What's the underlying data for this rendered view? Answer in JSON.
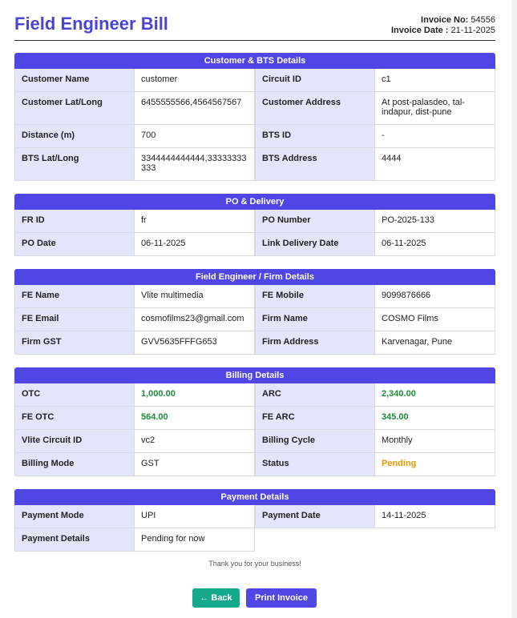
{
  "header": {
    "title": "Field Engineer Bill",
    "invoice_no_label": "Invoice No:",
    "invoice_no": "54556",
    "invoice_date_label": "Invoice Date :",
    "invoice_date": "21-11-2025"
  },
  "sections": {
    "customer": {
      "title": "Customer & BTS Details",
      "rows": [
        [
          "Customer Name",
          "customer",
          "Circuit ID",
          "c1"
        ],
        [
          "Customer Lat/Long",
          "6455555566,4564567567",
          "Customer Address",
          "At post-palasdeo, tal-indapur, dist-pune"
        ],
        [
          "Distance (m)",
          "700",
          "BTS ID",
          "-"
        ],
        [
          "BTS Lat/Long",
          "3344444444444,33333333333",
          "BTS Address",
          "4444"
        ]
      ]
    },
    "po": {
      "title": "PO & Delivery",
      "rows": [
        [
          "FR ID",
          "fr",
          "PO Number",
          "PO-2025-133"
        ],
        [
          "PO Date",
          "06-11-2025",
          "Link Delivery Date",
          "06-11-2025"
        ]
      ]
    },
    "fe": {
      "title": "Field Engineer / Firm Details",
      "rows": [
        [
          "FE Name",
          "Vlite multimedia",
          "FE Mobile",
          "9099876666"
        ],
        [
          "FE Email",
          "cosmofilms23@gmail.com",
          "Firm Name",
          "COSMO Films"
        ],
        [
          "Firm GST",
          "GVV5635FFFG653",
          "Firm Address",
          "Karvenagar, Pune"
        ]
      ]
    },
    "billing": {
      "title": "Billing Details",
      "rows": [
        [
          "OTC",
          "1,000.00",
          "ARC",
          "2,340.00"
        ],
        [
          "FE OTC",
          "564.00",
          "FE ARC",
          "345.00"
        ],
        [
          "Vlite Circuit ID",
          "vc2",
          "Billing Cycle",
          "Monthly"
        ],
        [
          "Billing Mode",
          "GST",
          "Status",
          "Pending"
        ]
      ]
    },
    "payment": {
      "title": "Payment Details",
      "rows": [
        [
          "Payment Mode",
          "UPI",
          "Payment Date",
          "14-11-2025"
        ],
        [
          "Payment Details",
          "Pending for now"
        ]
      ]
    }
  },
  "footer": {
    "thanks": "Thank you for your business!",
    "back_label": "← Back",
    "print_label": "Print Invoice"
  },
  "colors": {
    "accent": "#4f46e5",
    "label_bg": "#e3e6fb",
    "amount_green": "#1c8a3a",
    "status_pending": "#e69a00",
    "back_button": "#14a98a"
  }
}
